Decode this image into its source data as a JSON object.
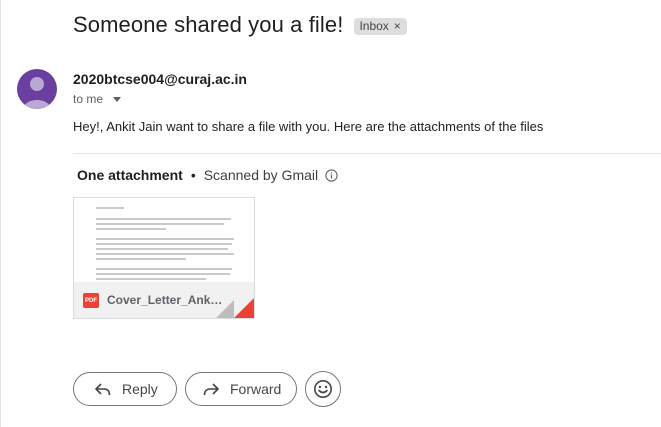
{
  "email": {
    "subject": "Someone shared you a file!",
    "label_chip": {
      "text": "Inbox",
      "remove_glyph": "×"
    },
    "sender": "2020btcse004@curaj.ac.in",
    "recipient": "to me",
    "body": "Hey!, Ankit Jain want to share a file with you. Here are the attachments of the files"
  },
  "attachments": {
    "count_label": "One attachment",
    "separator": "•",
    "scan_label": "Scanned by Gmail",
    "items": [
      {
        "file_name": "Cover_Letter_Ankit_Jain.pdf",
        "type_badge": "PDF"
      }
    ]
  },
  "actions": {
    "reply_label": "Reply",
    "forward_label": "Forward"
  },
  "icons": {
    "avatar": "default-avatar-icon",
    "recipient_caret": "caret-down-icon",
    "info": "info-circle-icon",
    "reply": "reply-arrow-icon",
    "forward": "forward-arrow-icon",
    "emoji": "emoji-smile-icon"
  },
  "colors": {
    "avatar_bg": "#6a3fa0",
    "pdf_red": "#ea4335",
    "chip_bg": "#dddddd",
    "button_border": "#747775"
  }
}
